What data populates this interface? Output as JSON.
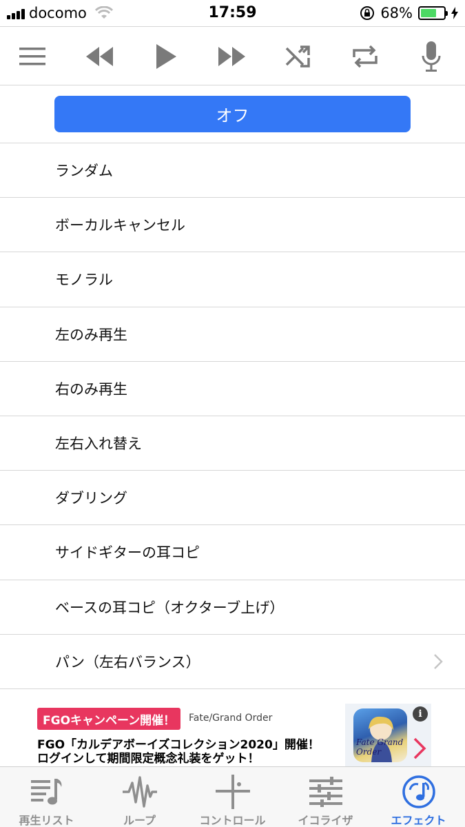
{
  "status_bar": {
    "carrier": "docomo",
    "time": "17:59",
    "battery_percent": "68%",
    "battery_level": 0.68,
    "battery_color": "#4cd964"
  },
  "toolbar": {
    "icons": [
      "menu-icon",
      "rewind-icon",
      "play-icon",
      "fast-forward-icon",
      "shuffle-icon",
      "repeat-icon",
      "microphone-icon"
    ]
  },
  "off_button": {
    "label": "オフ",
    "color": "#3478f6"
  },
  "effects": [
    {
      "label": "ランダム",
      "has_chevron": false
    },
    {
      "label": "ボーカルキャンセル",
      "has_chevron": false
    },
    {
      "label": "モノラル",
      "has_chevron": false
    },
    {
      "label": "左のみ再生",
      "has_chevron": false
    },
    {
      "label": "右のみ再生",
      "has_chevron": false
    },
    {
      "label": "左右入れ替え",
      "has_chevron": false
    },
    {
      "label": "ダブリング",
      "has_chevron": false
    },
    {
      "label": "サイドギターの耳コピ",
      "has_chevron": false
    },
    {
      "label": "ベースの耳コピ（オクターブ上げ）",
      "has_chevron": false
    },
    {
      "label": "パン（左右バランス）",
      "has_chevron": true
    }
  ],
  "ad": {
    "badge": "FGOキャンペーン開催！",
    "advertiser": "Fate/Grand Order",
    "line1": "FGO「カルデアボーイズコレクション2020」開催！",
    "line2": "ログインして期間限定概念礼装をゲット！",
    "thumb_text": "Fate Grand Order",
    "info": "i",
    "badge_color": "#e8365f"
  },
  "tabbar": {
    "tabs": [
      {
        "label": "再生リスト",
        "icon": "playlist-icon",
        "active": false
      },
      {
        "label": "ループ",
        "icon": "waveform-icon",
        "active": false
      },
      {
        "label": "コントロール",
        "icon": "control-icon",
        "active": false
      },
      {
        "label": "イコライザ",
        "icon": "equalizer-icon",
        "active": false
      },
      {
        "label": "エフェクト",
        "icon": "effect-icon",
        "active": true
      }
    ],
    "active_color": "#2f6fe0",
    "inactive_color": "#8e8e8e"
  }
}
